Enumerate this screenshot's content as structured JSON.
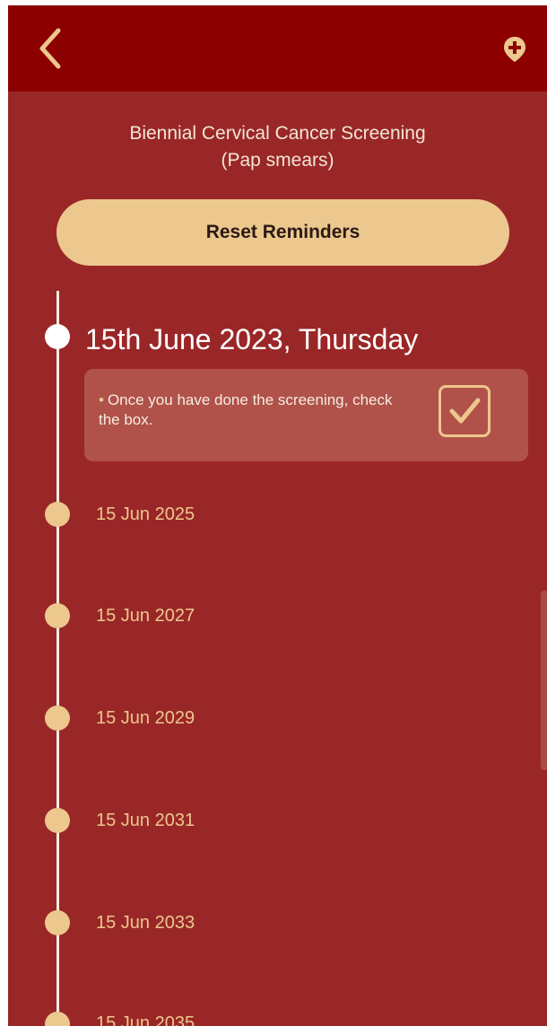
{
  "header": {
    "back_icon": "chevron-left-icon",
    "add_icon": "location-add-icon"
  },
  "screening": {
    "title_line1": "Biennial Cervical Cancer Screening",
    "title_line2": "(Pap smears)"
  },
  "reset_button_label": "Reset Reminders",
  "current": {
    "date": "15th June 2023, Thursday",
    "instruction": "Once you have done the screening, check the box.",
    "checked": true
  },
  "upcoming": [
    {
      "date": "15 Jun 2025"
    },
    {
      "date": "15 Jun 2027"
    },
    {
      "date": "15 Jun 2029"
    },
    {
      "date": "15 Jun 2031"
    },
    {
      "date": "15 Jun 2033"
    },
    {
      "date": "15 Jun 2035"
    }
  ],
  "colors": {
    "header_bg": "#8c0000",
    "page_bg": "#9a2727",
    "accent": "#ecc78e",
    "card_bg": "#b0524a"
  }
}
